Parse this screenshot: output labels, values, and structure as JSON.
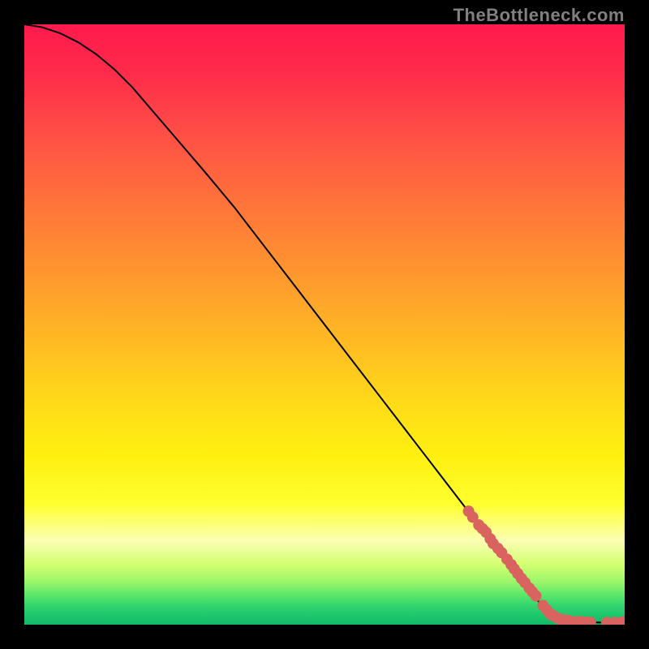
{
  "watermark": "TheBottleneck.com",
  "chart_data": {
    "type": "line",
    "title": "",
    "xlabel": "",
    "ylabel": "",
    "xlim": [
      0,
      100
    ],
    "ylim": [
      0,
      100
    ],
    "grid": false,
    "series": [
      {
        "name": "curve",
        "style": "line",
        "color": "#000000",
        "x": [
          0,
          3,
          6,
          9,
          12,
          15,
          18,
          21,
          24,
          27,
          30,
          35,
          40,
          45,
          50,
          55,
          60,
          65,
          70,
          75,
          80,
          85,
          87,
          89,
          90,
          92,
          94,
          96,
          98,
          100
        ],
        "y": [
          100,
          99.5,
          98.5,
          97,
          95,
          92.5,
          89.5,
          86,
          82.5,
          79,
          75.5,
          69.5,
          63,
          56.5,
          50,
          43.5,
          37,
          30.5,
          24,
          17.5,
          11,
          4.5,
          2.6,
          1.3,
          0.9,
          0.55,
          0.4,
          0.35,
          0.35,
          0.5
        ]
      },
      {
        "name": "points",
        "style": "scatter",
        "color": "#d9645f",
        "x": [
          74.0,
          74.7,
          75.7,
          76.3,
          76.9,
          77.6,
          78.1,
          78.9,
          79.5,
          80.4,
          81.1,
          81.6,
          82.2,
          82.8,
          83.4,
          84.1,
          84.6,
          85.2,
          86.4,
          87.0,
          87.6,
          88.1,
          88.8,
          89.3,
          90.0,
          90.7,
          92.0,
          92.8,
          93.5,
          94.3,
          97.0,
          98.2,
          99.4,
          100.0
        ],
        "y": [
          18.9,
          17.9,
          16.6,
          16.0,
          15.4,
          14.3,
          13.5,
          12.7,
          12.0,
          10.9,
          10.0,
          9.3,
          8.5,
          7.7,
          7.0,
          6.1,
          5.5,
          4.8,
          3.2,
          2.5,
          1.8,
          1.5,
          1.1,
          0.9,
          0.8,
          0.7,
          0.5,
          0.5,
          0.4,
          0.4,
          0.35,
          0.35,
          0.4,
          0.5
        ]
      }
    ]
  }
}
